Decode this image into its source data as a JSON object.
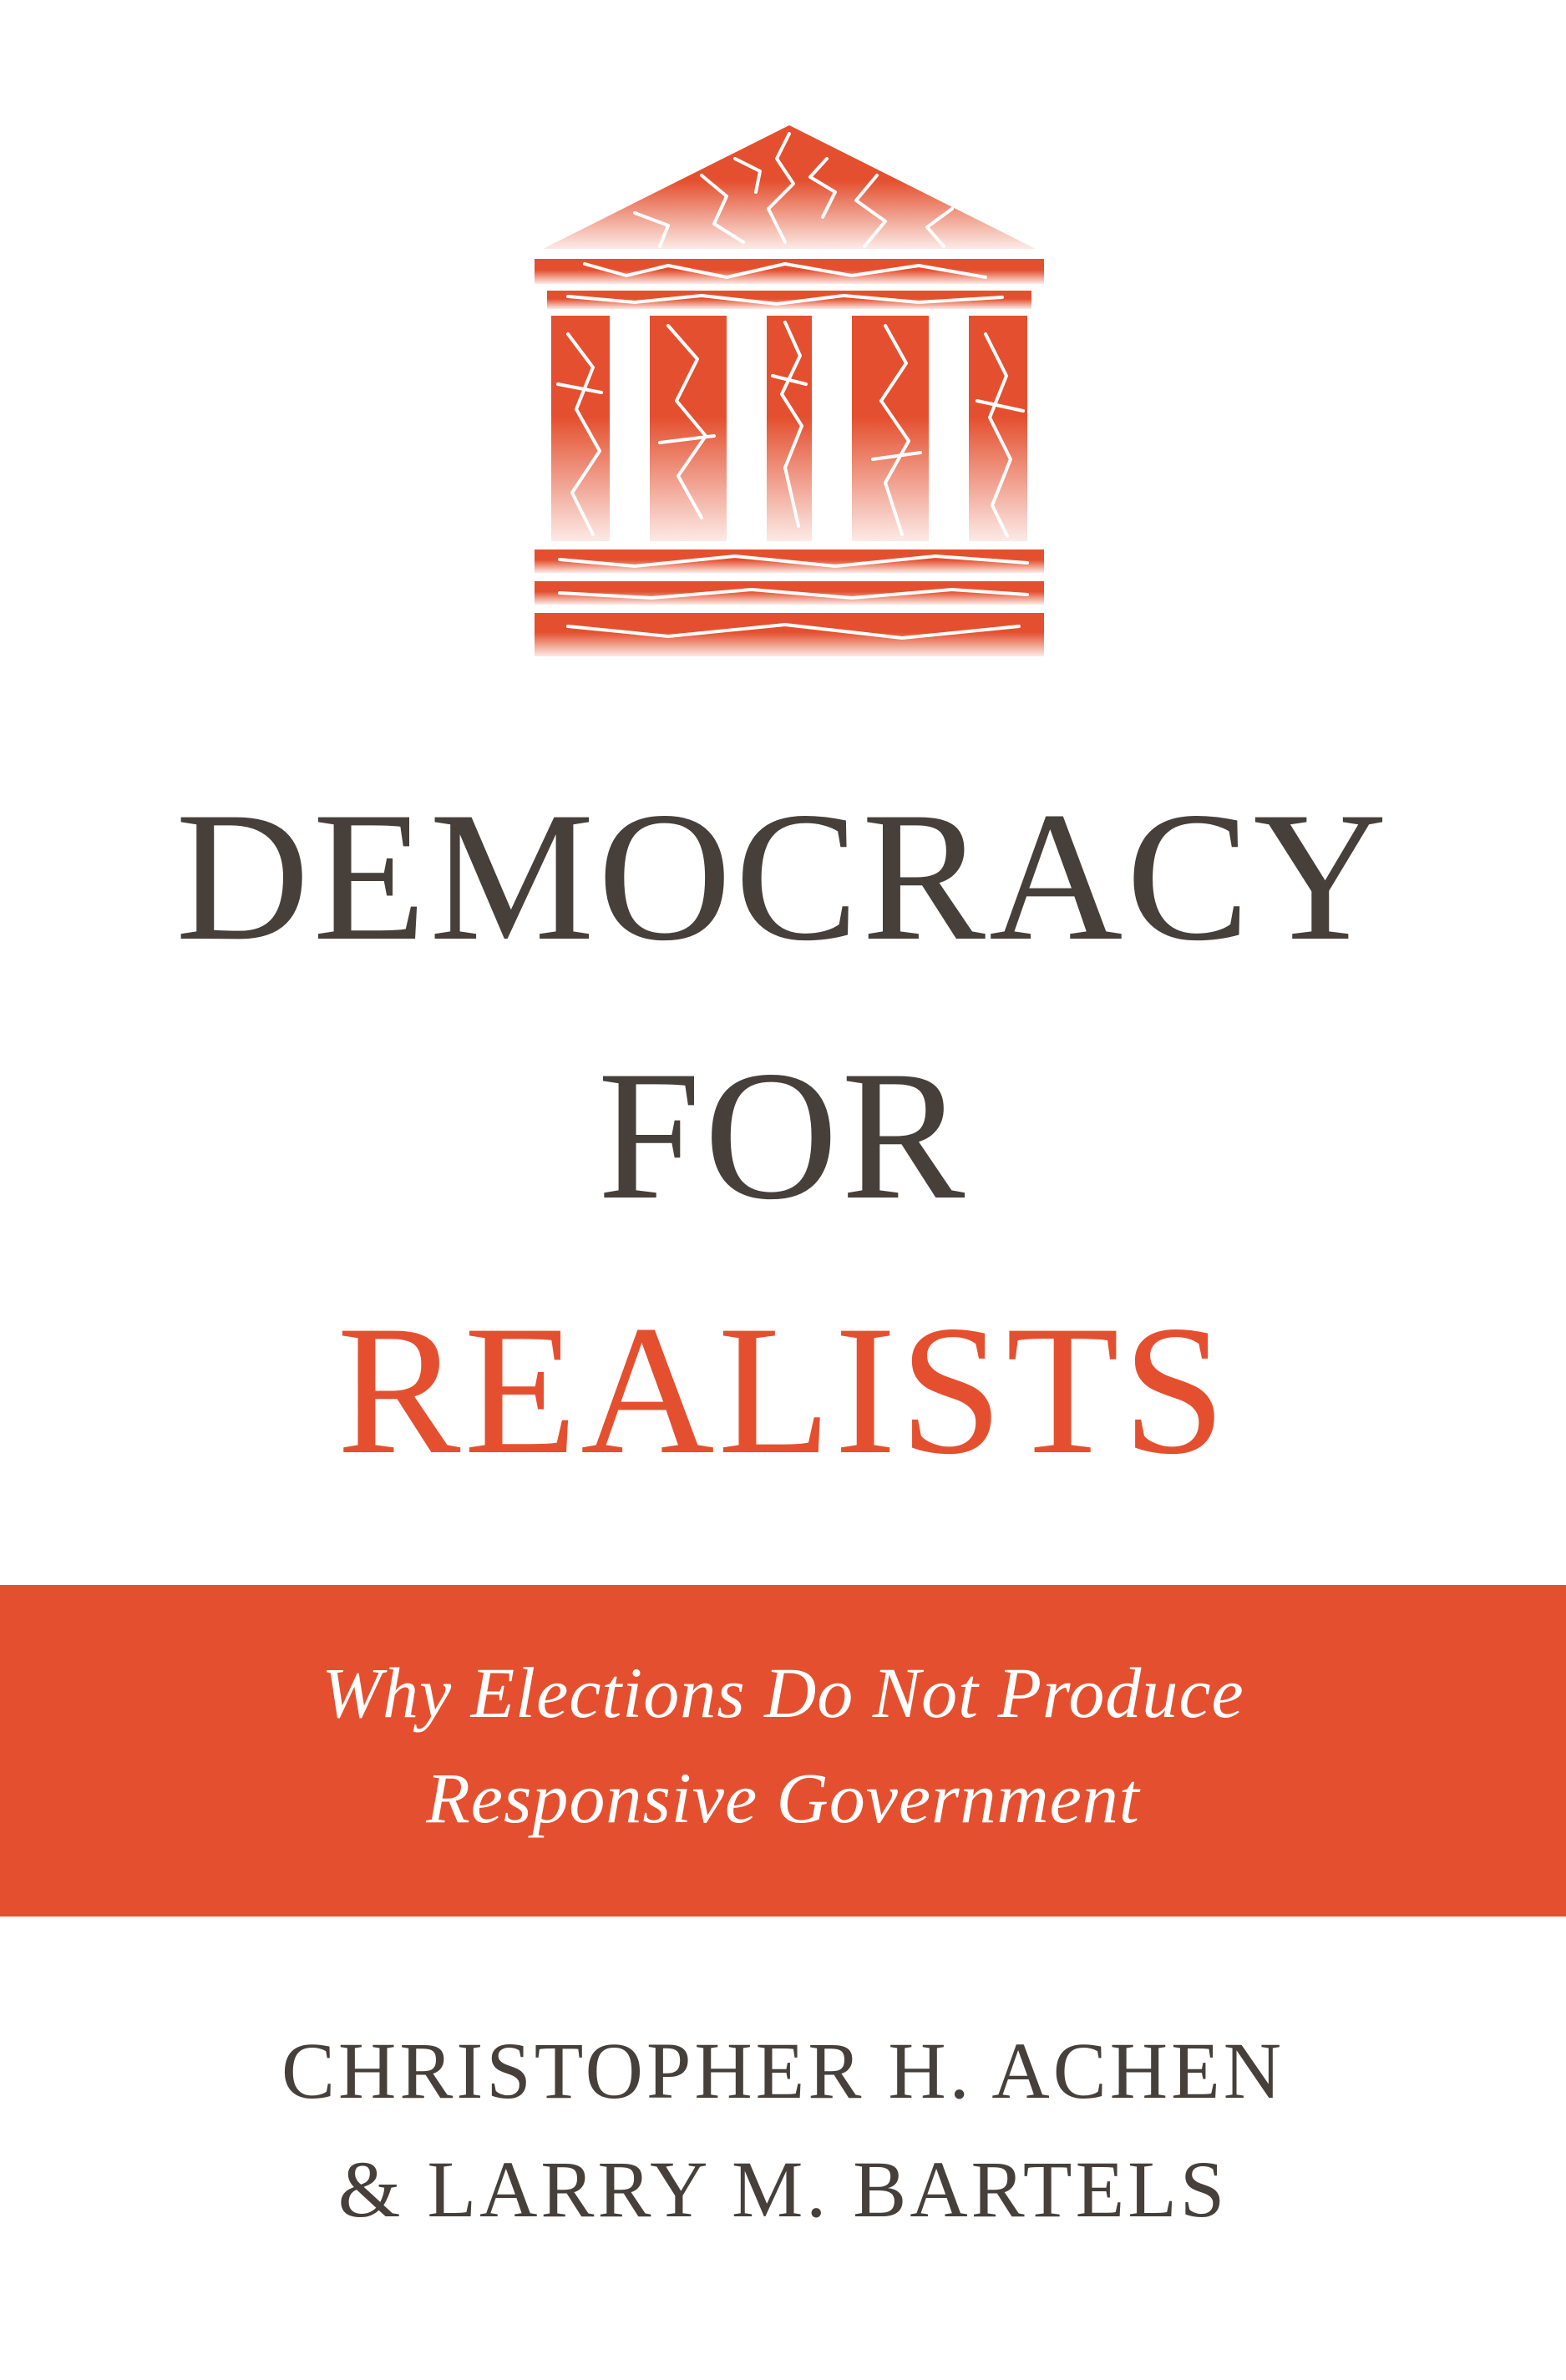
{
  "cover": {
    "title_line1": "DEMOCRACY",
    "title_line2": "FOR",
    "title_line3": "REALISTS",
    "subtitle_line1": "Why Elections Do Not Produce",
    "subtitle_line2": "Responsive Government",
    "author_line1": "CHRISTOPHER H. ACHEN",
    "author_line2": "& LARRY M. BARTELS"
  },
  "colors": {
    "accent": "#e4502f",
    "title_dark": "#463f3a",
    "background": "#ffffff"
  },
  "logo": {
    "icon": "cracked-temple-icon"
  }
}
